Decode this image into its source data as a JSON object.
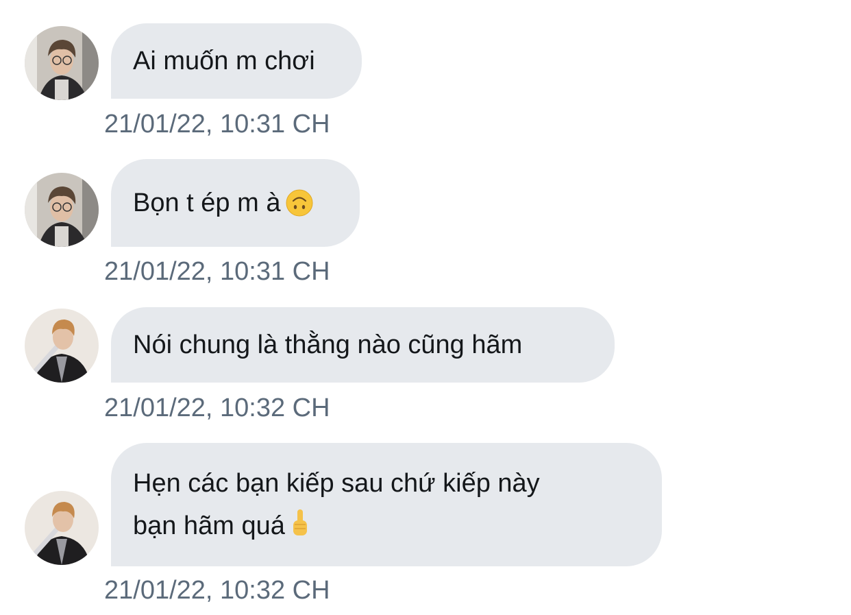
{
  "messages": [
    {
      "text": "Ai muốn m chơi",
      "timestamp": "21/01/22, 10:31 CH",
      "avatar": "avatar-glasses"
    },
    {
      "text": "Bọn t ép m à",
      "emoji": "upside-down-face-icon",
      "timestamp": "21/01/22, 10:31 CH",
      "avatar": "avatar-glasses"
    },
    {
      "text": "Nói chung là thằng nào cũng hãm",
      "timestamp": "21/01/22, 10:32 CH",
      "avatar": "avatar-jacket"
    },
    {
      "text": "Hẹn các bạn kiếp sau chứ kiếp này\nbạn hãm quá",
      "emoji": "middle-finger-icon",
      "timestamp": "21/01/22, 10:32 CH",
      "avatar": "avatar-jacket"
    }
  ],
  "colors": {
    "bubble_background": "#e6e9ed",
    "message_text": "#14171a",
    "timestamp_text": "#5b6a7a",
    "page_background": "#ffffff"
  }
}
